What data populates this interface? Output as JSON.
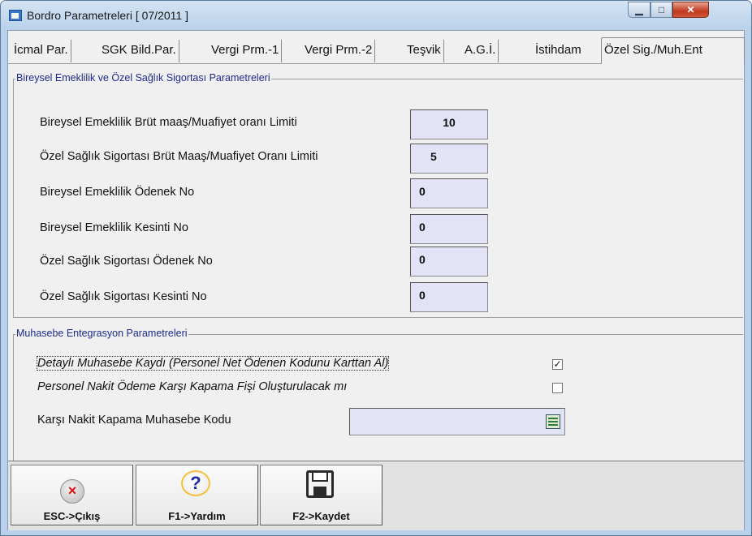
{
  "window": {
    "title": "Bordro Parametreleri [ 07/2011 ]",
    "controls": {
      "minimize": "▁",
      "maximize": "□",
      "close": "✕"
    }
  },
  "tabs": [
    {
      "label": "İcmal Par."
    },
    {
      "label": "SGK Bild.Par."
    },
    {
      "label": "Vergi Prm.-1"
    },
    {
      "label": "Vergi Prm.-2"
    },
    {
      "label": "Teşvik"
    },
    {
      "label": "A.G.İ."
    },
    {
      "label": "İstihdam"
    },
    {
      "label": "Özel Sig./Muh.Ent",
      "active": true
    }
  ],
  "section1": {
    "legend": "Bireysel Emeklilik ve Özel Sağlık Sigortası Parametreleri",
    "rows": [
      {
        "label": "Bireysel Emeklilik Brüt maaş/Muafiyet oranı Limiti",
        "value": "10"
      },
      {
        "label": "Özel Sağlık Sigortası Brüt Maaş/Muafiyet Oranı Limiti",
        "value": "5"
      },
      {
        "label": "Bireysel Emeklilik Ödenek No",
        "value": "0"
      },
      {
        "label": "Bireysel Emeklilik Kesinti No",
        "value": "0"
      },
      {
        "label": "Özel Sağlık Sigortası Ödenek No",
        "value": "0"
      },
      {
        "label": "Özel Sağlık Sigortası Kesinti No",
        "value": "0"
      }
    ]
  },
  "section2": {
    "legend": "Muhasebe Entegrasyon Parametreleri",
    "detayli": {
      "label": "Detaylı Muhasebe Kaydı  (Personel Net Ödenen Kodunu Karttan Al)",
      "checked": true,
      "mark": "✓"
    },
    "nakit": {
      "label": "Personel Nakit Ödeme Karşı Kapama Fişi Oluşturulacak mı",
      "checked": false,
      "mark": ""
    },
    "kod": {
      "label": "Karşı Nakit Kapama Muhasebe Kodu",
      "value": ""
    }
  },
  "toolbar": {
    "esc": {
      "label": "ESC->Çıkış",
      "glyph": "×"
    },
    "help": {
      "label": "F1->Yardım",
      "glyph": "?"
    },
    "save": {
      "label": "F2->Kaydet"
    }
  }
}
